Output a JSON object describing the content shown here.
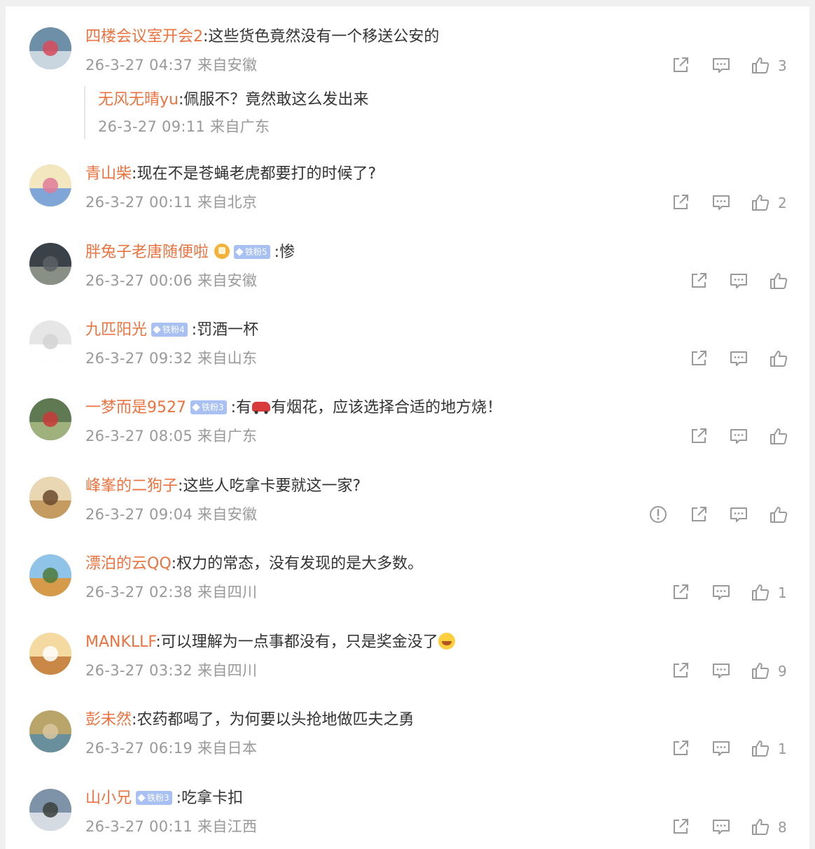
{
  "comments": [
    {
      "user": "四楼会议室开会2",
      "sep": ":",
      "text": "这些货色竟然没有一个移送公安的",
      "time": "26-3-27 04:37",
      "location": "来自安徽",
      "likes": "3",
      "avatar_colors": [
        "#6d8fa8",
        "#c9d6e0",
        "#d84a5a"
      ],
      "reply": {
        "user": "无风无晴yu",
        "sep": ":",
        "text": "佩服不？竟然敢这么发出来",
        "time": "26-3-27 09:11",
        "location": "来自广东"
      }
    },
    {
      "user": "青山柴",
      "sep": ":",
      "text": "现在不是苍蝇老虎都要打的时候了?",
      "time": "26-3-27 00:11",
      "location": "来自北京",
      "likes": "2",
      "avatar_colors": [
        "#f3e7c0",
        "#7fa6d6",
        "#e07a9a"
      ]
    },
    {
      "user": "胖兔子老唐随便啦",
      "badge": "铁粉5",
      "vip": true,
      "sep": ":",
      "text": "惨",
      "time": "26-3-27 00:06",
      "location": "来自安徽",
      "likes": "",
      "avatar_colors": [
        "#3a4148",
        "#8a8f86",
        "#5b6064"
      ]
    },
    {
      "user": "九匹阳光",
      "badge": "铁粉4",
      "sep": ":",
      "text": "罚酒一杯",
      "time": "26-3-27 09:32",
      "location": "来自山东",
      "likes": "",
      "avatar_colors": [
        "#e6e6e6",
        "#ffffff",
        "#d3d3d3"
      ]
    },
    {
      "user": "一梦而是9527",
      "badge": "铁粉3",
      "sep": ":",
      "text": "有",
      "text2": "有烟花，应该选择合适的地方烧！",
      "car": true,
      "time": "26-3-27 08:05",
      "location": "来自广东",
      "likes": "",
      "avatar_colors": [
        "#5f7a52",
        "#9fb27e",
        "#c83a3a"
      ]
    },
    {
      "user": "峰峯的二狗子",
      "sep": ":",
      "text": "这些人吃拿卡要就这一家?",
      "time": "26-3-27 09:04",
      "location": "来自安徽",
      "likes": "",
      "report": true,
      "avatar_colors": [
        "#e9d6b2",
        "#c59b62",
        "#6b4a2e"
      ]
    },
    {
      "user": "漂泊的云QQ",
      "sep": ":",
      "text": "权力的常态，没有发现的是大多数。",
      "time": "26-3-27 02:38",
      "location": "来自四川",
      "likes": "1",
      "avatar_colors": [
        "#8fc3e8",
        "#d69b4a",
        "#4f7a3a"
      ]
    },
    {
      "user": "MANKLLF",
      "sep": ":",
      "text": "可以理解为一点事都没有，只是奖金没了",
      "emoji": true,
      "time": "26-3-27 03:32",
      "location": "来自四川",
      "likes": "9",
      "avatar_colors": [
        "#f4d9a0",
        "#c98846",
        "#ffffff"
      ]
    },
    {
      "user": "彭未然",
      "sep": ":",
      "text": "农药都喝了，为何要以头抢地做匹夫之勇",
      "time": "26-3-27 06:19",
      "location": "来自日本",
      "likes": "1",
      "avatar_colors": [
        "#b9a46a",
        "#6a8f9c",
        "#d9c7a0"
      ]
    },
    {
      "user": "山小兄",
      "badge": "铁粉3",
      "sep": ":",
      "text": "吃拿卡扣",
      "time": "26-3-27 00:11",
      "location": "来自江西",
      "likes": "8",
      "avatar_colors": [
        "#7f93a8",
        "#d4dbe2",
        "#3b3f3c"
      ]
    }
  ],
  "icons": {
    "share": "share-icon",
    "comment": "comment-icon",
    "like": "like-icon",
    "report": "report-icon"
  },
  "colors": {
    "username": "#eb7340",
    "meta": "#999999",
    "badge": "#a9c1f2"
  }
}
